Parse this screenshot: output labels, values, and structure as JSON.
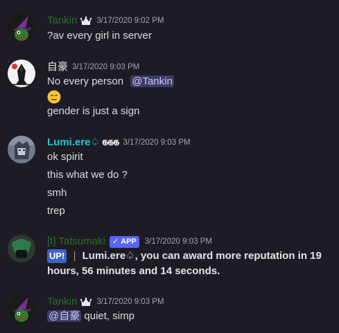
{
  "colors": {
    "background": "#1f1b24",
    "tankin_name": "#2b6f2e",
    "jigo_name": "#e6e6e6",
    "lumi_name": "#1ec8d6",
    "tatsumaki_name": "#2b6f2e",
    "mention_bg": "#3c3a66",
    "app_badge": "#5865f2"
  },
  "messages": [
    {
      "author": "Tankin",
      "author_badge": "crown-icon",
      "timestamp": "3/17/2020 9:02 PM",
      "lines": [
        "?av every girl in server"
      ]
    },
    {
      "author": "自豪",
      "timestamp": "3/17/2020 9:03 PM",
      "lines": [
        {
          "text": "No every person",
          "mention": "@Tankin"
        },
        {
          "emoji": "expressionless-face"
        },
        "gender is just a sign"
      ]
    },
    {
      "author": "Lumi.ere♤",
      "author_roles": "𝕲𝕲𝕲",
      "timestamp": "3/17/2020 9:03 PM",
      "lines": [
        "ok spirit",
        "this what we do ?",
        "smh",
        "trep"
      ]
    },
    {
      "author": "[t] Tatsumaki",
      "badge": "APP",
      "timestamp": "3/17/2020 9:03 PM",
      "up_label": "UP!",
      "separator": "|",
      "line1": "Lumi.ere♤, you can award more reputation in 19",
      "line2": "hours, 56 minutes and 14 seconds."
    },
    {
      "author": "Tankin",
      "author_badge": "crown-icon",
      "timestamp": "3/17/2020 9:03 PM",
      "mention": "@自豪",
      "text": " quiet, simp"
    }
  ]
}
